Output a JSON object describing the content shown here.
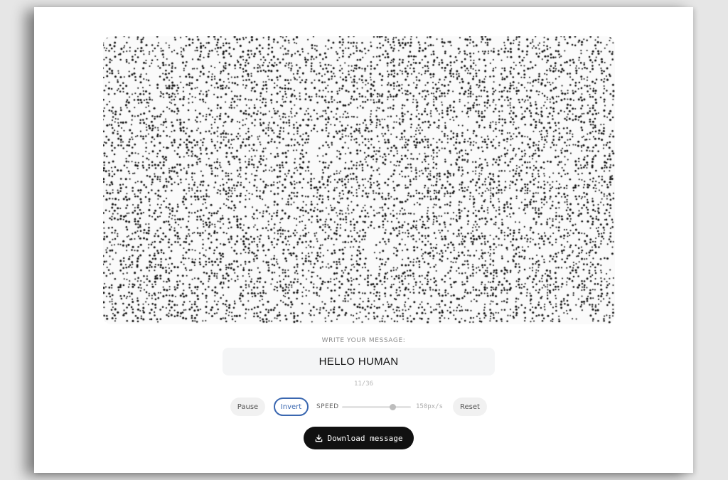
{
  "message_section": {
    "label": "WRITE YOUR MESSAGE:",
    "value": "HELLO HUMAN",
    "counter": "11/36"
  },
  "controls": {
    "pause_label": "Pause",
    "invert_label": "Invert",
    "invert_active": true,
    "speed_label": "SPEED",
    "speed_value": "150px/s",
    "speed_fraction": 0.73,
    "reset_label": "Reset"
  },
  "download": {
    "label": "Download message",
    "icon": "download-icon"
  },
  "colors": {
    "page_background": "#e6e6e6",
    "card_background": "#ffffff",
    "dot_color": "#111111",
    "accent": "#3a67b0",
    "download_background": "#111111"
  }
}
